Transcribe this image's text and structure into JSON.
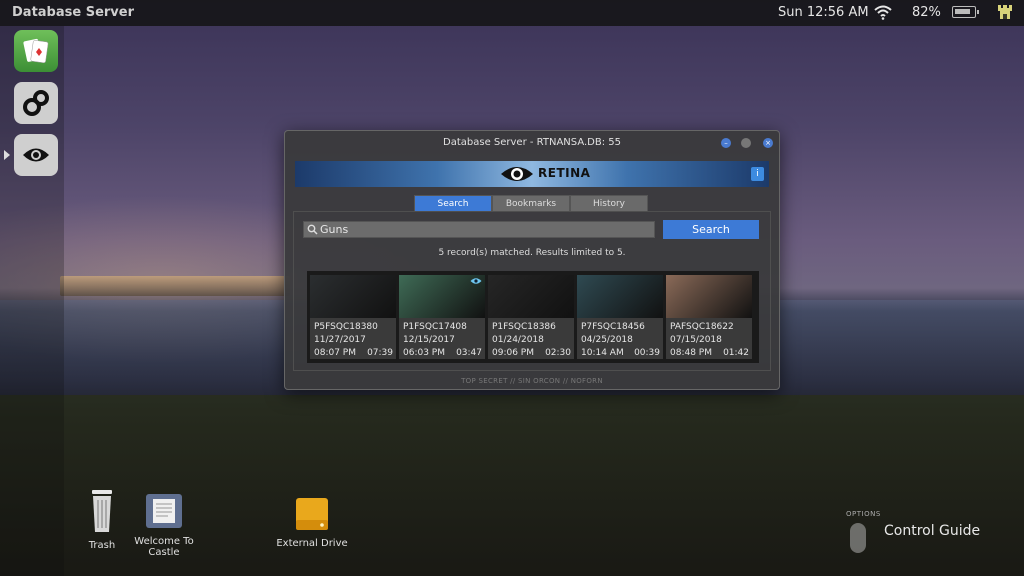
{
  "topbar": {
    "app_title": "Database Server",
    "clock": "Sun 12:56 AM",
    "battery_percent": "82%",
    "battery_level": 0.82
  },
  "dock": {
    "items": [
      "solitaire-cards-icon",
      "gears-icon",
      "eye-icon"
    ]
  },
  "window": {
    "title": "Database Server - RTNANSA.DB: 55",
    "banner_logo": "RETINA",
    "info_label": "i",
    "tabs": [
      {
        "label": "Search",
        "active": true
      },
      {
        "label": "Bookmarks",
        "active": false
      },
      {
        "label": "History",
        "active": false
      }
    ],
    "search": {
      "value": "Guns",
      "button_label": "Search"
    },
    "result_count": "5 record(s) matched. Results limited to 5.",
    "results": [
      {
        "id": "P5FSQC18380",
        "date": "11/27/2017",
        "time": "08:07 PM",
        "duration": "07:39",
        "thumb_color": "#2b2e30",
        "viewed": false
      },
      {
        "id": "P1FSQC17408",
        "date": "12/15/2017",
        "time": "06:03 PM",
        "duration": "03:47",
        "thumb_color": "#3f6b56",
        "viewed": true
      },
      {
        "id": "P1FSQC18386",
        "date": "01/24/2018",
        "time": "09:06 PM",
        "duration": "02:30",
        "thumb_color": "#262626",
        "viewed": false
      },
      {
        "id": "P7FSQC18456",
        "date": "04/25/2018",
        "time": "10:14 AM",
        "duration": "00:39",
        "thumb_color": "#2f4a52",
        "viewed": false
      },
      {
        "id": "PAFSQC18622",
        "date": "07/15/2018",
        "time": "08:48 PM",
        "duration": "01:42",
        "thumb_color": "#8a6a58",
        "viewed": false
      }
    ],
    "footer_classification": "TOP SECRET // SIN ORCON // NOFORN"
  },
  "desktop": {
    "icons": [
      {
        "label": "Trash",
        "icon": "trash-icon"
      },
      {
        "label": "Welcome To Castle",
        "icon": "document-icon"
      },
      {
        "label": "External Drive",
        "icon": "drive-icon"
      }
    ],
    "options_label": "OPTIONS",
    "control_guide": "Control Guide"
  },
  "colors": {
    "accent": "#3d7ad6",
    "window_bg": "#3a3a3c",
    "dock_cards": "#4fa83f"
  }
}
